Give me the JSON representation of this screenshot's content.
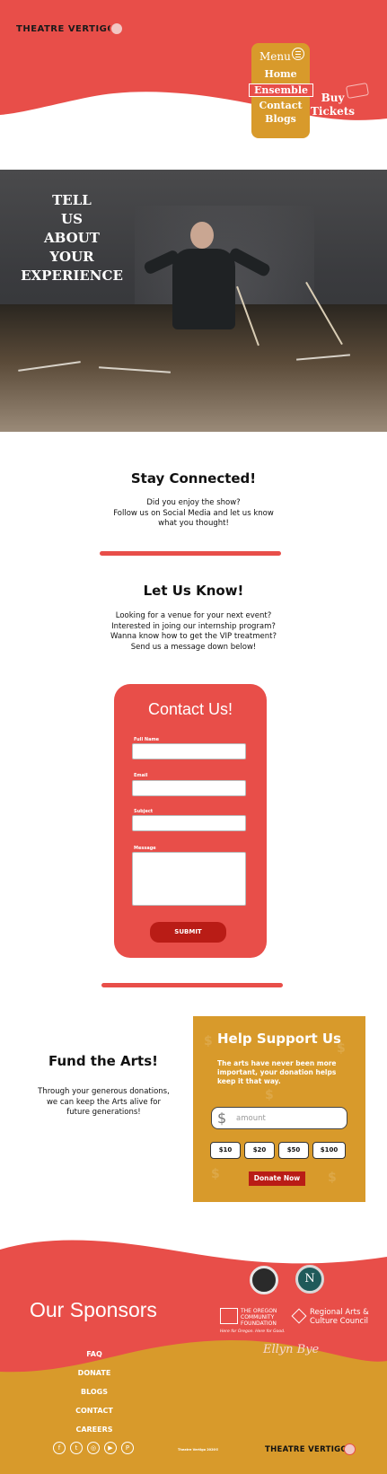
{
  "header": {
    "logo": "THEATRE VERTIGO",
    "menu_title": "Menu",
    "menu_items": [
      "Home",
      "Ensemble",
      "Contact",
      "Blogs"
    ],
    "active_item": "Ensemble",
    "buy_tickets": [
      "Buy",
      "Tickets"
    ]
  },
  "hero": {
    "title_lines": [
      "TELL",
      "US",
      "ABOUT",
      "YOUR",
      "EXPERIENCE"
    ]
  },
  "stay_connected": {
    "title": "Stay Connected!",
    "lines": [
      "Did you enjoy the show?",
      "Follow us on Social Media and let us know",
      "what you thought!"
    ]
  },
  "let_us_know": {
    "title": "Let Us Know!",
    "lines": [
      "Looking for a venue for your next event?",
      "Interested in joing our internship program?",
      "Wanna know how to get the VIP treatment?",
      "Send us a message down below!"
    ]
  },
  "contact": {
    "title": "Contact Us!",
    "fields": [
      {
        "label": "Full Name"
      },
      {
        "label": "Email"
      },
      {
        "label": "Subject"
      },
      {
        "label": "Message"
      }
    ],
    "submit": "SUBMIT"
  },
  "fund": {
    "title": "Fund the Arts!",
    "lines": [
      "Through your generous donations,",
      "we can keep the Arts alive for",
      "future generations!"
    ]
  },
  "donate": {
    "title": "Help Support Us",
    "text_lines": [
      "The arts have never been more",
      "important, your donation helps",
      "keep it that way."
    ],
    "currency": "$",
    "amount_placeholder": "amount",
    "presets": [
      "$10",
      "$20",
      "$50",
      "$100"
    ],
    "button": "Donate Now"
  },
  "footer": {
    "sponsors_title": "Our Sponsors",
    "sponsors": {
      "oregon_lines": [
        "THE OREGON",
        "COMMUNITY",
        "FOUNDATION"
      ],
      "oregon_tagline": "Here for Oregon. Here for Good.",
      "racc_lines": [
        "Regional Arts &",
        "Culture Council"
      ],
      "signature": "Ellyn Bye"
    },
    "links": [
      "FAQ",
      "DONATE",
      "BLOGS",
      "CONTACT",
      "CAREERS"
    ],
    "social_icons": [
      "facebook-icon",
      "twitter-icon",
      "instagram-icon",
      "youtube-icon",
      "patreon-icon"
    ],
    "copyright": "Theatre Vertigo 2020©",
    "logo": "THEATRE VERTIGO"
  },
  "colors": {
    "accent_red": "#e84e49",
    "gold": "#d89a2b",
    "dark_red": "#b91c16"
  }
}
